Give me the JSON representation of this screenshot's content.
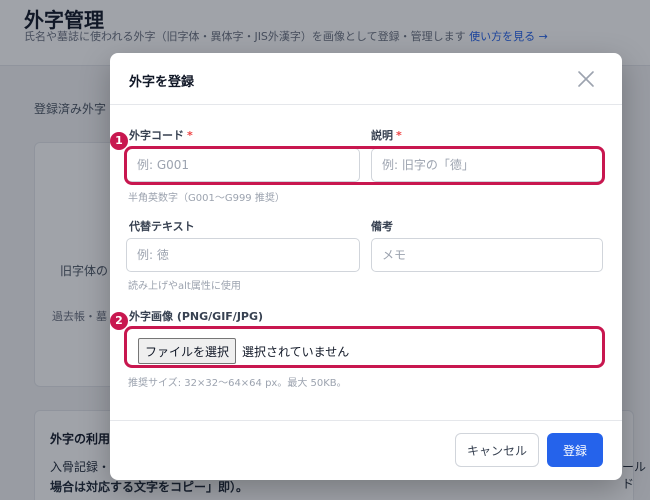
{
  "page": {
    "title": "外字管理",
    "description": "氏名や墓誌に使われる外字（旧字体・異体字・JIS外漢字）を画像として登録・管理します",
    "help_link": "使い方を見る →",
    "registered_label": "登録済み外字",
    "empty_text": "旧字体の",
    "empty_subtext": "過去帳・墓",
    "usage_title": "外字の利用",
    "usage_line": "入骨記録・",
    "usage_line2": "場合は対応する文字をコピー」即）。",
    "usage_right": "ールド"
  },
  "modal": {
    "title": "外字を登録",
    "fields": {
      "code": {
        "label": "外字コード",
        "required_mark": "*",
        "placeholder": "例: G001",
        "hint": "半角英数字（G001〜G999 推奨）"
      },
      "description": {
        "label": "説明",
        "required_mark": "*",
        "placeholder": "例: 旧字の「德」"
      },
      "alt_text": {
        "label": "代替テキスト",
        "placeholder": "例: 徳",
        "hint": "読み上げやalt属性に使用"
      },
      "note": {
        "label": "備考",
        "placeholder": "メモ"
      },
      "image": {
        "label": "外字画像 (PNG/GIF/JPG)",
        "button": "ファイルを選択",
        "status": "選択されていません",
        "hint": "推奨サイズ: 32×32〜64×64 px。最大 50KB。"
      }
    },
    "markers": [
      "1",
      "2"
    ],
    "cancel_label": "キャンセル",
    "submit_label": "登録"
  },
  "colors": {
    "accent": "#2563eb",
    "highlight": "#c8174f",
    "required": "#ef4444"
  }
}
